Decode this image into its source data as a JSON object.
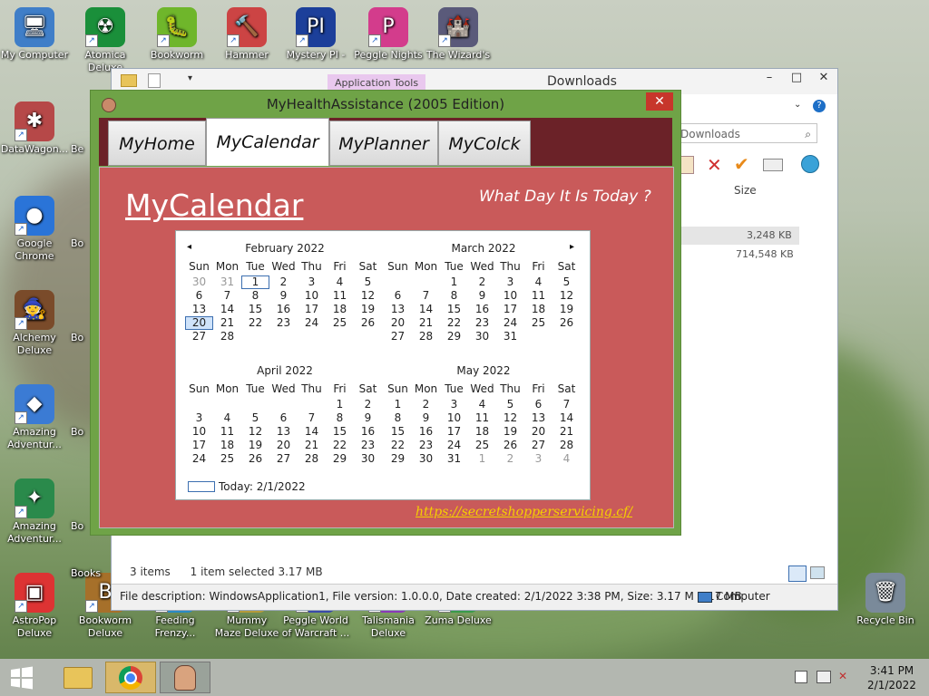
{
  "desktop": {
    "icons": [
      {
        "label": "My Computer",
        "glyph": "🖥",
        "color": "#3f7ec8"
      },
      {
        "label": "Atomica Deluxe",
        "glyph": "☢",
        "color": "#1a8f3a"
      },
      {
        "label": "Bookworm",
        "glyph": "🐛",
        "color": "#6fb62b"
      },
      {
        "label": "Hammer",
        "glyph": "🔨",
        "color": "#c44"
      },
      {
        "label": "Mystery PI -",
        "glyph": "PI",
        "color": "#1c3f9a"
      },
      {
        "label": "Peggle Nights",
        "glyph": "P",
        "color": "#d33c8c"
      },
      {
        "label": "The Wizard's",
        "glyph": "🏰",
        "color": "#5a5a7a"
      },
      {
        "label": "DataWagon...",
        "glyph": "✱",
        "color": "#b64848"
      },
      {
        "label": "Google Chrome",
        "glyph": "●",
        "color": "#2a74d8"
      },
      {
        "label": "Alchemy Deluxe",
        "glyph": "🧙",
        "color": "#7a4b2a"
      },
      {
        "label": "Amazing Adventur...",
        "glyph": "◆",
        "color": "#3b7bd4"
      },
      {
        "label": "Amazing Adventur...",
        "glyph": "✦",
        "color": "#2a8a4b"
      },
      {
        "label": "AstroPop Deluxe",
        "glyph": "▣",
        "color": "#d33"
      },
      {
        "label": "Bookworm Deluxe",
        "glyph": "B",
        "color": "#a6702a"
      },
      {
        "label": "Feeding Frenzy...",
        "glyph": "🐟",
        "color": "#2a8ac4"
      },
      {
        "label": "Mummy Maze Deluxe",
        "glyph": "☥",
        "color": "#b59a3a"
      },
      {
        "label": "Peggle World of Warcraft ...",
        "glyph": "P",
        "color": "#3a4aa8"
      },
      {
        "label": "Talismania Deluxe",
        "glyph": "✶",
        "color": "#8a3ab8"
      },
      {
        "label": "Zuma Deluxe",
        "glyph": "Z",
        "color": "#3a9a4a"
      },
      {
        "label": "Recycle Bin",
        "glyph": "🗑",
        "color": "#7a8a9a"
      },
      {
        "label": "Be",
        "glyph": "",
        "color": "#888"
      },
      {
        "label": "Bo",
        "glyph": "",
        "color": "#888"
      },
      {
        "label": "Bo",
        "glyph": "",
        "color": "#888"
      },
      {
        "label": "Bo",
        "glyph": "",
        "color": "#888"
      },
      {
        "label": "Bo",
        "glyph": "",
        "color": "#888"
      },
      {
        "label": "Bo",
        "glyph": "",
        "color": "#888"
      },
      {
        "label": "Books",
        "glyph": "",
        "color": "#888"
      }
    ]
  },
  "explorer": {
    "title": "Downloads",
    "ribbon_context_tab": "Application Tools",
    "search_placeholder": "Downloads",
    "column_size": "Size",
    "file_sizes": [
      "3,248 KB",
      "714,548 KB"
    ],
    "items_count": "3 items",
    "selection": "1 item selected  3.17 MB",
    "description": "File description: WindowsApplication1, File version: 1.0.0.0, Date created: 2/1/2022 3:38 PM, Size: 3.17 M  3.17 MB",
    "location": "Computer"
  },
  "app": {
    "title": "MyHealthAssistance (2005 Edition)",
    "close_label": "✕",
    "tabs": [
      "MyHome",
      "MyCalendar",
      "MyPlanner",
      "MyColck"
    ],
    "active_tab": "MyCalendar",
    "heading": "MyCalendar",
    "tagline": "What Day It Is Today ?",
    "link": "https://secretshopperservicing.cf/",
    "colors": {
      "title_bar": "#6fa347",
      "tab_bar": "#6b2228",
      "content": "#c95a5a",
      "link": "#f5d000"
    }
  },
  "calendar": {
    "weekdays": [
      "Sun",
      "Mon",
      "Tue",
      "Wed",
      "Thu",
      "Fri",
      "Sat"
    ],
    "today_label": "Today: 2/1/2022",
    "selected_date": "2/20/2022",
    "months": [
      {
        "title": "February 2022",
        "weeks": [
          [
            "30",
            "31",
            "1",
            "2",
            "3",
            "4",
            "5"
          ],
          [
            "6",
            "7",
            "8",
            "9",
            "10",
            "11",
            "12"
          ],
          [
            "13",
            "14",
            "15",
            "16",
            "17",
            "18",
            "19"
          ],
          [
            "20",
            "21",
            "22",
            "23",
            "24",
            "25",
            "26"
          ],
          [
            "27",
            "28",
            "",
            "",
            "",
            "",
            ""
          ]
        ]
      },
      {
        "title": "March 2022",
        "weeks": [
          [
            "",
            "",
            "1",
            "2",
            "3",
            "4",
            "5"
          ],
          [
            "6",
            "7",
            "8",
            "9",
            "10",
            "11",
            "12"
          ],
          [
            "13",
            "14",
            "15",
            "16",
            "17",
            "18",
            "19"
          ],
          [
            "20",
            "21",
            "22",
            "23",
            "24",
            "25",
            "26"
          ],
          [
            "27",
            "28",
            "29",
            "30",
            "31",
            "",
            ""
          ]
        ]
      },
      {
        "title": "April 2022",
        "weeks": [
          [
            "",
            "",
            "",
            "",
            "",
            "1",
            "2"
          ],
          [
            "3",
            "4",
            "5",
            "6",
            "7",
            "8",
            "9"
          ],
          [
            "10",
            "11",
            "12",
            "13",
            "14",
            "15",
            "16"
          ],
          [
            "17",
            "18",
            "19",
            "20",
            "21",
            "22",
            "23"
          ],
          [
            "24",
            "25",
            "26",
            "27",
            "28",
            "29",
            "30"
          ]
        ]
      },
      {
        "title": "May 2022",
        "weeks": [
          [
            "1",
            "2",
            "3",
            "4",
            "5",
            "6",
            "7"
          ],
          [
            "8",
            "9",
            "10",
            "11",
            "12",
            "13",
            "14"
          ],
          [
            "15",
            "16",
            "17",
            "18",
            "19",
            "20",
            "21"
          ],
          [
            "22",
            "23",
            "24",
            "25",
            "26",
            "27",
            "28"
          ],
          [
            "29",
            "30",
            "31",
            "1",
            "2",
            "3",
            "4"
          ]
        ]
      }
    ]
  },
  "taskbar": {
    "time": "3:41 PM",
    "date": "2/1/2022"
  }
}
